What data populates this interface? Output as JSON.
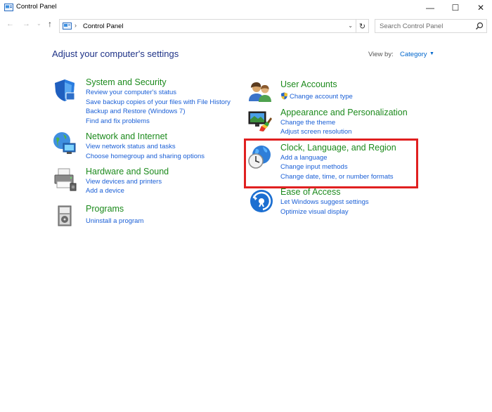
{
  "window": {
    "title": "Control Panel",
    "minimize_glyph": "—",
    "maximize_glyph": "☐",
    "close_glyph": "✕"
  },
  "nav": {
    "back_glyph": "←",
    "forward_glyph": "→",
    "recent_glyph": "⌄",
    "up_glyph": "↑",
    "breadcrumb_sep": "›",
    "address": "Control Panel",
    "dropdown_glyph": "⌄",
    "refresh_glyph": "↻",
    "search_placeholder": "Search Control Panel"
  },
  "header": {
    "title": "Adjust your computer's settings",
    "view_by_label": "View by:",
    "view_by_value": "Category",
    "view_by_caret": "▼"
  },
  "categories": {
    "system": {
      "title": "System and Security",
      "icon": "shield-icon",
      "links": [
        "Review your computer's status",
        "Save backup copies of your files with File History",
        "Backup and Restore (Windows 7)",
        "Find and fix problems"
      ]
    },
    "network": {
      "title": "Network and Internet",
      "icon": "network-globe-icon",
      "links": [
        "View network status and tasks",
        "Choose homegroup and sharing options"
      ]
    },
    "hardware": {
      "title": "Hardware and Sound",
      "icon": "printer-icon",
      "links": [
        "View devices and printers",
        "Add a device"
      ]
    },
    "programs": {
      "title": "Programs",
      "icon": "programs-icon",
      "links": [
        "Uninstall a program"
      ]
    },
    "users": {
      "title": "User Accounts",
      "icon": "users-icon",
      "links": [
        "Change account type"
      ]
    },
    "appearance": {
      "title": "Appearance and Personalization",
      "icon": "appearance-icon",
      "links": [
        "Change the theme",
        "Adjust screen resolution"
      ]
    },
    "clock": {
      "title": "Clock, Language, and Region",
      "icon": "clock-globe-icon",
      "links": [
        "Add a language",
        "Change input methods",
        "Change date, time, or number formats"
      ]
    },
    "ease": {
      "title": "Ease of Access",
      "icon": "ease-of-access-icon",
      "links": [
        "Let Windows suggest settings",
        "Optimize visual display"
      ]
    }
  },
  "colors": {
    "category_title": "#1c8a1c",
    "link": "#1a5fd6",
    "page_title": "#1e3287",
    "highlight": "#e02020"
  }
}
